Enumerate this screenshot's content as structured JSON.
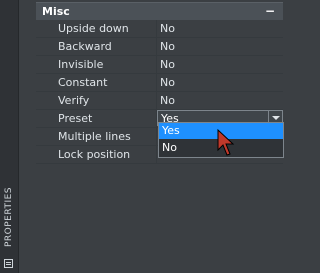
{
  "sidebar": {
    "title": "PROPERTIES",
    "icon": "properties-panel-icon"
  },
  "section": {
    "title": "Misc",
    "collapse_symbol": "−"
  },
  "properties": [
    {
      "name": "Upside down",
      "value": "No"
    },
    {
      "name": "Backward",
      "value": "No"
    },
    {
      "name": "Invisible",
      "value": "No"
    },
    {
      "name": "Constant",
      "value": "No"
    },
    {
      "name": "Verify",
      "value": "No"
    },
    {
      "name": "Preset",
      "value": "Yes"
    },
    {
      "name": "Multiple lines",
      "value": ""
    },
    {
      "name": "Lock position",
      "value": ""
    }
  ],
  "dropdown": {
    "options": [
      "Yes",
      "No"
    ],
    "selected": "Yes"
  },
  "colors": {
    "panel_bg": "#3b3f43",
    "header_bg": "#4b5157",
    "highlight": "#1e90ff",
    "cursor": "#c0392b"
  }
}
